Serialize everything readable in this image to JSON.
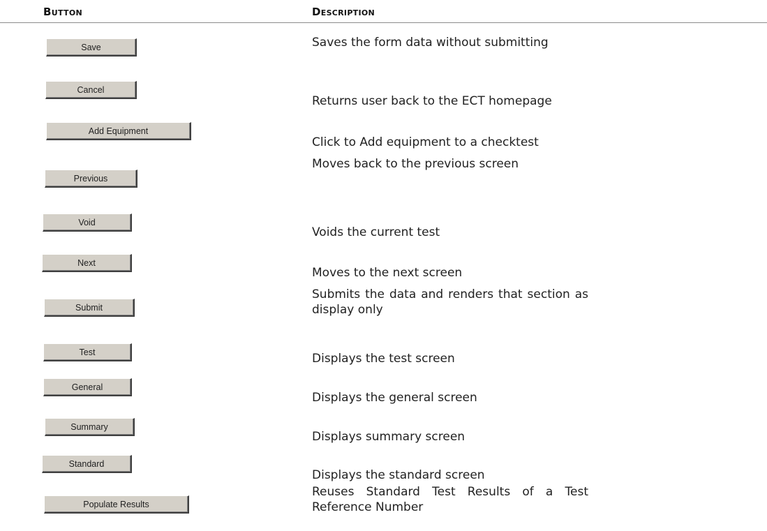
{
  "header": {
    "button_col": "Button",
    "description_col": "Description"
  },
  "rows": [
    {
      "button": "Save",
      "description": "Saves the form data without submitting"
    },
    {
      "button": "Cancel",
      "description": "Returns user back to the ECT homepage"
    },
    {
      "button": "Add Equipment",
      "description": "Click to Add equipment to a checktest"
    },
    {
      "button": "Previous",
      "description": "Moves back to the previous screen"
    },
    {
      "button": "Void",
      "description": "Voids the current test"
    },
    {
      "button": "Next",
      "description": "Moves to the next screen"
    },
    {
      "button": "Submit",
      "description": "Submits the data and renders that section as display only"
    },
    {
      "button": "Test",
      "description": "Displays the test screen"
    },
    {
      "button": "General",
      "description": "Displays the general screen"
    },
    {
      "button": "Summary",
      "description": "Displays summary screen"
    },
    {
      "button": "Standard",
      "description": "Displays the standard screen"
    },
    {
      "button": "Populate Results",
      "description": "Reuses Standard Test Results of a Test Reference Number"
    }
  ]
}
